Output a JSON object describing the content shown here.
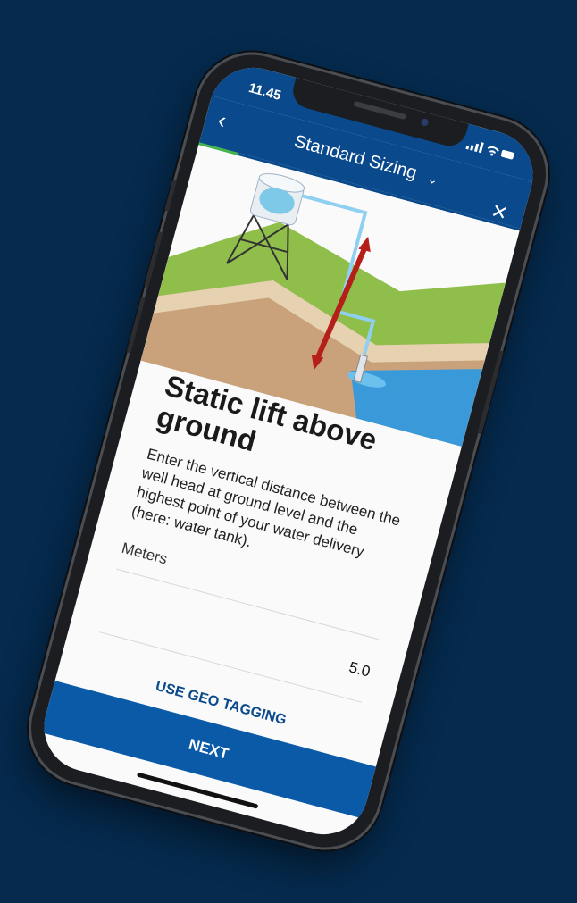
{
  "status_bar": {
    "time": "11.45",
    "icons": "signal wifi battery"
  },
  "app_bar": {
    "title": "Standard Sizing",
    "back_icon": "chevron-left-icon",
    "dropdown_icon": "chevron-down-icon",
    "close_icon": "close-icon"
  },
  "progress": {
    "fraction": 0.12
  },
  "step": {
    "heading": "Static lift above ground",
    "description": "Enter the vertical distance between the well head at ground level and the highest point of your water delivery (here: water tank)."
  },
  "field": {
    "label": "Meters",
    "value": "5.0"
  },
  "actions": {
    "geo_tagging": "USE GEO TAGGING",
    "next": "NEXT"
  },
  "colors": {
    "brand_blue": "#0a4a8c",
    "accent_green": "#43b549",
    "arrow_red": "#b41f1a",
    "background": "#052a4d"
  }
}
